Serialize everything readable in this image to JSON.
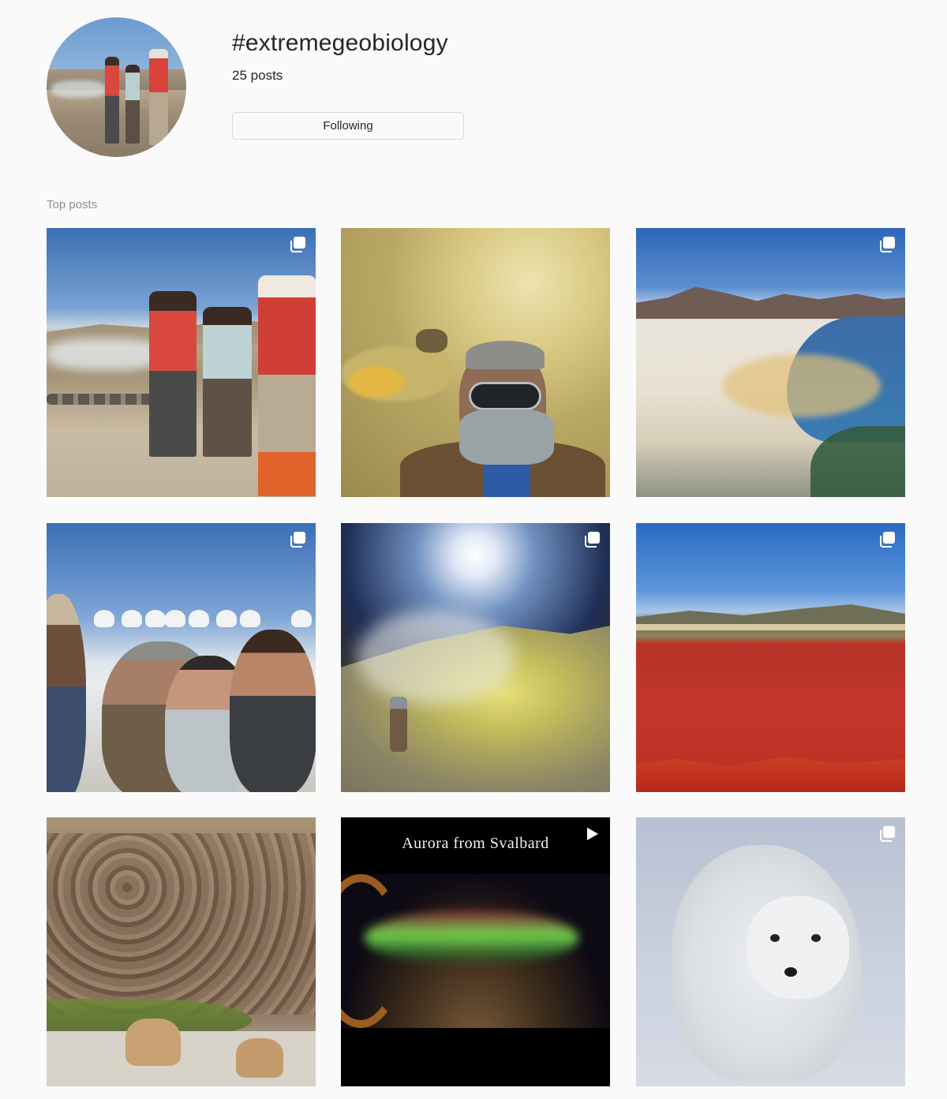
{
  "header": {
    "hashtag": "#extremegeobiology",
    "post_count": "25",
    "post_count_label": "posts",
    "follow_button_label": "Following"
  },
  "section": {
    "title": "Top posts"
  },
  "posts": [
    {
      "type": "carousel",
      "badge": "carousel-icon"
    },
    {
      "type": "image",
      "badge": ""
    },
    {
      "type": "carousel",
      "badge": "carousel-icon"
    },
    {
      "type": "carousel",
      "badge": "carousel-icon"
    },
    {
      "type": "carousel",
      "badge": "carousel-icon"
    },
    {
      "type": "carousel",
      "badge": "carousel-icon"
    },
    {
      "type": "image",
      "badge": ""
    },
    {
      "type": "video",
      "badge": "play-icon",
      "caption": "Aurora from Svalbard"
    },
    {
      "type": "carousel",
      "badge": "carousel-icon"
    }
  ],
  "colors": {
    "background": "#fafafa",
    "text": "#262626",
    "muted": "#8e8e8e",
    "border": "#dbdbdb"
  }
}
